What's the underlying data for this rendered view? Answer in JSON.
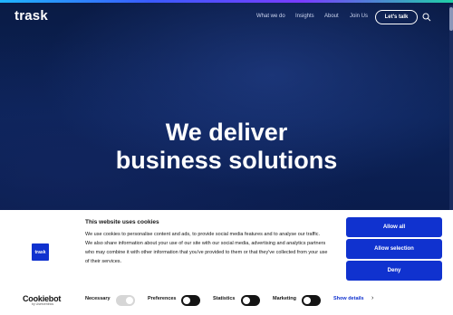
{
  "header": {
    "logo": "trask",
    "nav": [
      "What we do",
      "Insights",
      "About",
      "Join Us"
    ],
    "cta_label": "Let's talk",
    "search_icon": "search-icon"
  },
  "hero": {
    "headline_line1": "We deliver",
    "headline_line2": "business solutions"
  },
  "cookie_banner": {
    "logo_text": "trask",
    "title": "This website uses cookies",
    "body": "We use cookies to personalise content and ads, to provide social media features and to analyse our traffic. We also share information about your use of our site with our social media, advertising and analytics partners who may combine it with other information that you've provided to them or that they've collected from your use of their services.",
    "buttons": {
      "allow_all": "Allow all",
      "allow_selection": "Allow selection",
      "deny": "Deny"
    },
    "brand": {
      "name": "Cookiebot",
      "sub": "by Usercentrics"
    },
    "preferences": [
      {
        "label": "Necessary",
        "checked": true
      },
      {
        "label": "Preferences",
        "checked": false
      },
      {
        "label": "Statistics",
        "checked": false
      },
      {
        "label": "Marketing",
        "checked": false
      }
    ],
    "show_details": "Show details",
    "accent_color": "#1032cf"
  }
}
